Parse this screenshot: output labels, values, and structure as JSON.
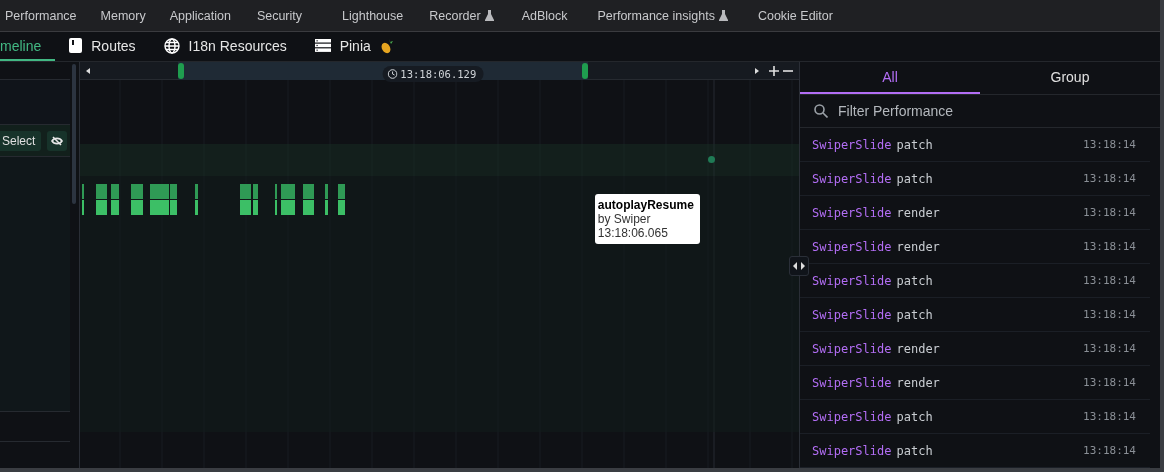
{
  "devtools_tabs": [
    {
      "label": "Performance",
      "experimental": false
    },
    {
      "label": "Memory",
      "experimental": false
    },
    {
      "label": "Application",
      "experimental": false
    },
    {
      "label": "Security",
      "experimental": false
    },
    {
      "label": "Lighthouse",
      "experimental": false
    },
    {
      "label": "Recorder",
      "experimental": true
    },
    {
      "label": "AdBlock",
      "experimental": false
    },
    {
      "label": "Performance insights",
      "experimental": true
    },
    {
      "label": "Cookie Editor",
      "experimental": false
    }
  ],
  "panel_tabs": [
    {
      "label": "meline",
      "kind": "none",
      "selected": true
    },
    {
      "label": "Routes",
      "kind": "book",
      "selected": false
    },
    {
      "label": "I18n Resources",
      "kind": "globe",
      "selected": false
    },
    {
      "label": "Pinia",
      "kind": "store",
      "selected": false
    }
  ],
  "timeline": {
    "time_badge": "13:18:06.129",
    "select_button": "Select"
  },
  "tooltip": {
    "title": "autoplayResume",
    "source": "by Swiper",
    "time": "13:18:06.065"
  },
  "sidebar": {
    "tabs": [
      {
        "label": "All",
        "selected": true
      },
      {
        "label": "Group",
        "selected": false
      }
    ],
    "filter": {
      "placeholder": "Filter Performance"
    },
    "events": [
      {
        "component": "SwiperSlide",
        "action": "patch",
        "time": "13:18:14"
      },
      {
        "component": "SwiperSlide",
        "action": "patch",
        "time": "13:18:14"
      },
      {
        "component": "SwiperSlide",
        "action": "render",
        "time": "13:18:14"
      },
      {
        "component": "SwiperSlide",
        "action": "render",
        "time": "13:18:14"
      },
      {
        "component": "SwiperSlide",
        "action": "patch",
        "time": "13:18:14"
      },
      {
        "component": "SwiperSlide",
        "action": "patch",
        "time": "13:18:14"
      },
      {
        "component": "SwiperSlide",
        "action": "render",
        "time": "13:18:14"
      },
      {
        "component": "SwiperSlide",
        "action": "render",
        "time": "13:18:14"
      },
      {
        "component": "SwiperSlide",
        "action": "patch",
        "time": "13:18:14"
      },
      {
        "component": "SwiperSlide",
        "action": "patch",
        "time": "13:18:14"
      }
    ]
  }
}
